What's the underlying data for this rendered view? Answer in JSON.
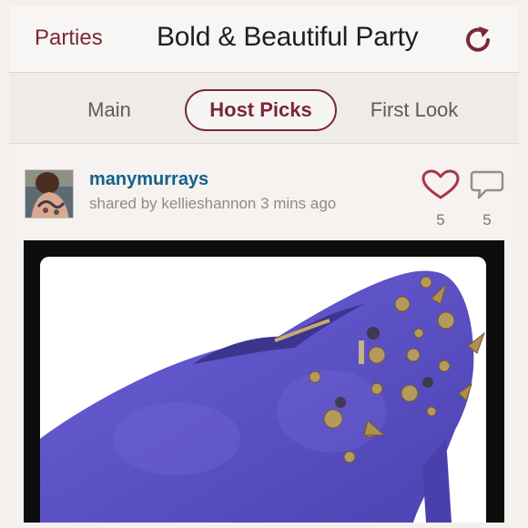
{
  "header": {
    "back_label": "Parties",
    "title": "Bold & Beautiful Party",
    "refresh_icon": "refresh-icon"
  },
  "tabs": [
    {
      "label": "Main",
      "active": false
    },
    {
      "label": "Host Picks",
      "active": true
    },
    {
      "label": "First Look",
      "active": false
    }
  ],
  "post": {
    "username": "manymurrays",
    "shared_by": "shared by kellieshannon 3 mins ago",
    "likes": "5",
    "comments": "5",
    "like_icon": "heart-icon",
    "comment_icon": "speech-bubble-icon",
    "image_alt": "blue suede spiked bootie"
  },
  "colors": {
    "accent": "#7a2737",
    "username": "#14618c",
    "shoe": "#5a4fc4"
  }
}
